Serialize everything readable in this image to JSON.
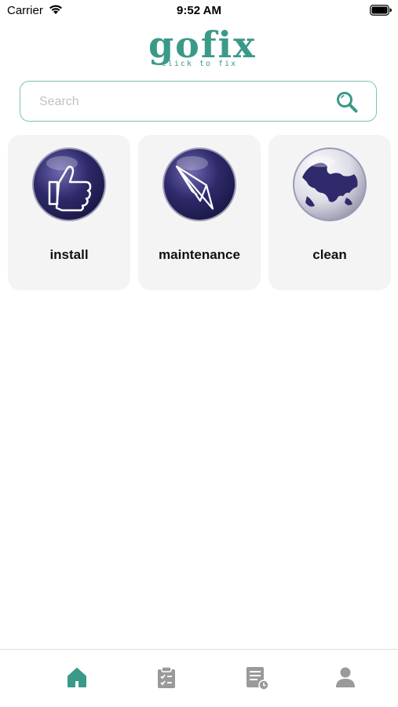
{
  "status_bar": {
    "carrier": "Carrier",
    "time": "9:52 AM"
  },
  "logo": {
    "word": "gofix",
    "tagline": "click to fix"
  },
  "search": {
    "placeholder": "Search",
    "value": ""
  },
  "categories": [
    {
      "label": "install",
      "icon": "thumbs-up-icon"
    },
    {
      "label": "maintenance",
      "icon": "paper-plane-icon"
    },
    {
      "label": "clean",
      "icon": "globe-icon"
    }
  ],
  "tab_bar": {
    "tabs": [
      {
        "name": "home",
        "icon": "home-icon",
        "active": true
      },
      {
        "name": "orders",
        "icon": "clipboard-icon",
        "active": false
      },
      {
        "name": "history",
        "icon": "document-clock-icon",
        "active": false
      },
      {
        "name": "profile",
        "icon": "user-icon",
        "active": false
      }
    ]
  },
  "colors": {
    "brand": "#3a9a88",
    "search_border": "#7cc3b4",
    "card_background": "#f4f4f4",
    "icon_sphere": "#2e2a6b",
    "tab_inactive": "#9a9a9a"
  }
}
